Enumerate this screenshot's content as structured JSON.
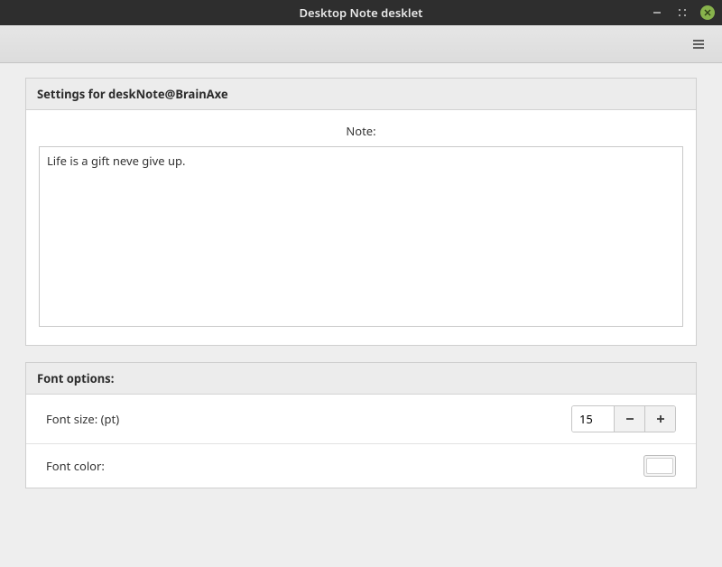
{
  "window": {
    "title": "Desktop Note desklet"
  },
  "settings_panel": {
    "header": "Settings for deskNote@BrainAxe",
    "note_label": "Note:",
    "note_value": "Life is a gift neve give up."
  },
  "font_panel": {
    "header": "Font options:",
    "size_label": "Font size: (pt)",
    "size_value": "15",
    "color_label": "Font color:",
    "color_value": "#ffffff"
  }
}
